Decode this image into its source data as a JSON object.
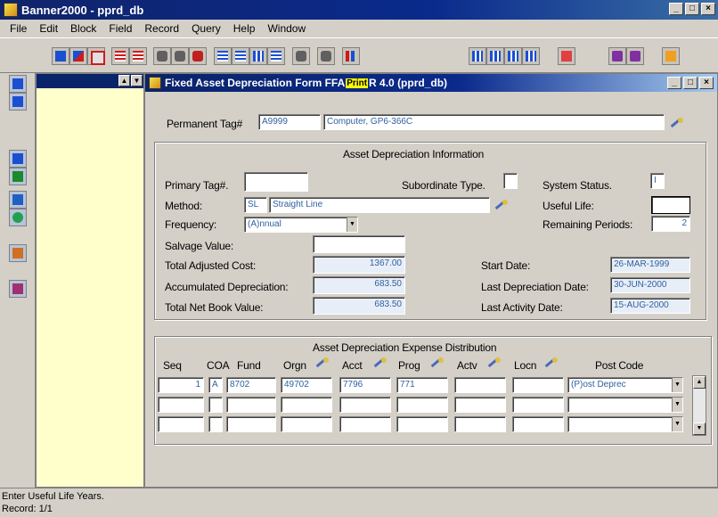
{
  "window": {
    "title": "Banner2000 - pprd_db",
    "min": "_",
    "max": "□",
    "close": "×"
  },
  "menu": [
    {
      "label": "File"
    },
    {
      "label": "Edit"
    },
    {
      "label": "Block"
    },
    {
      "label": "Field"
    },
    {
      "label": "Record"
    },
    {
      "label": "Query"
    },
    {
      "label": "Help"
    },
    {
      "label": "Window"
    }
  ],
  "toolbar_icons": [
    "save-icon",
    "rollback-icon",
    "exit-icon",
    "insert-record-icon",
    "remove-record-icon",
    "query-icon",
    "execute-query-icon",
    "cancel-query-icon",
    "previous-block-icon",
    "next-block-icon",
    "count-query-icon",
    "list-icon",
    "edit-icon",
    "print-icon",
    "chart-icon",
    "previous-record-icon",
    "next-record-icon",
    "previous-item-icon",
    "next-item-icon",
    "message-icon",
    "bookmark-icon",
    "online-help-icon"
  ],
  "form": {
    "title_prefix": "Fixed Asset Depreciation Form  FFA",
    "title_badge": "Print",
    "title_suffix": "R  4.0  (pprd_db)",
    "permanent_tag": {
      "label": "Permanent Tag#",
      "value": "A9999",
      "description": "Computer, GP6-366C"
    },
    "info_section": {
      "title": "Asset Depreciation Information",
      "primary_tag": {
        "label": "Primary Tag#.",
        "value": ""
      },
      "subordinate_type": {
        "label": "Subordinate Type.",
        "value": ""
      },
      "system_status": {
        "label": "System Status.",
        "value": "I"
      },
      "method": {
        "label": "Method:",
        "code": "SL",
        "description": "Straight Line"
      },
      "useful_life": {
        "label": "Useful Life:",
        "value": ""
      },
      "frequency": {
        "label": "Frequency:",
        "value": "(A)nnual"
      },
      "remaining_periods": {
        "label": "Remaining Periods:",
        "value": "2"
      },
      "salvage_value": {
        "label": "Salvage Value:",
        "value": ""
      },
      "total_adjusted_cost": {
        "label": "Total Adjusted Cost:",
        "value": "1367.00"
      },
      "start_date": {
        "label": "Start Date:",
        "value": "26-MAR-1999"
      },
      "accumulated_depreciation": {
        "label": "Accumulated Depreciation:",
        "value": "683.50"
      },
      "last_depreciation_date": {
        "label": "Last Depreciation Date:",
        "value": "30-JUN-2000"
      },
      "total_net_book_value": {
        "label": "Total Net Book Value:",
        "value": "683.50"
      },
      "last_activity_date": {
        "label": "Last Activity Date:",
        "value": "15-AUG-2000"
      }
    },
    "distribution_section": {
      "title": "Asset Depreciation Expense Distribution",
      "headers": {
        "seq": "Seq",
        "coa": "COA",
        "fund": "Fund",
        "orgn": "Orgn",
        "acct": "Acct",
        "prog": "Prog",
        "actv": "Actv",
        "locn": "Locn",
        "post_code": "Post Code"
      },
      "rows": [
        {
          "seq": "1",
          "coa": "A",
          "fund": "8702",
          "orgn": "49702",
          "acct": "7796",
          "prog": "771",
          "actv": "",
          "locn": "",
          "post_code": "(P)ost Deprec"
        },
        {
          "seq": "",
          "coa": "",
          "fund": "",
          "orgn": "",
          "acct": "",
          "prog": "",
          "actv": "",
          "locn": "",
          "post_code": ""
        },
        {
          "seq": "",
          "coa": "",
          "fund": "",
          "orgn": "",
          "acct": "",
          "prog": "",
          "actv": "",
          "locn": "",
          "post_code": ""
        }
      ]
    }
  },
  "status": {
    "hint": "Enter Useful Life Years.",
    "record": "Record: 1/1"
  }
}
